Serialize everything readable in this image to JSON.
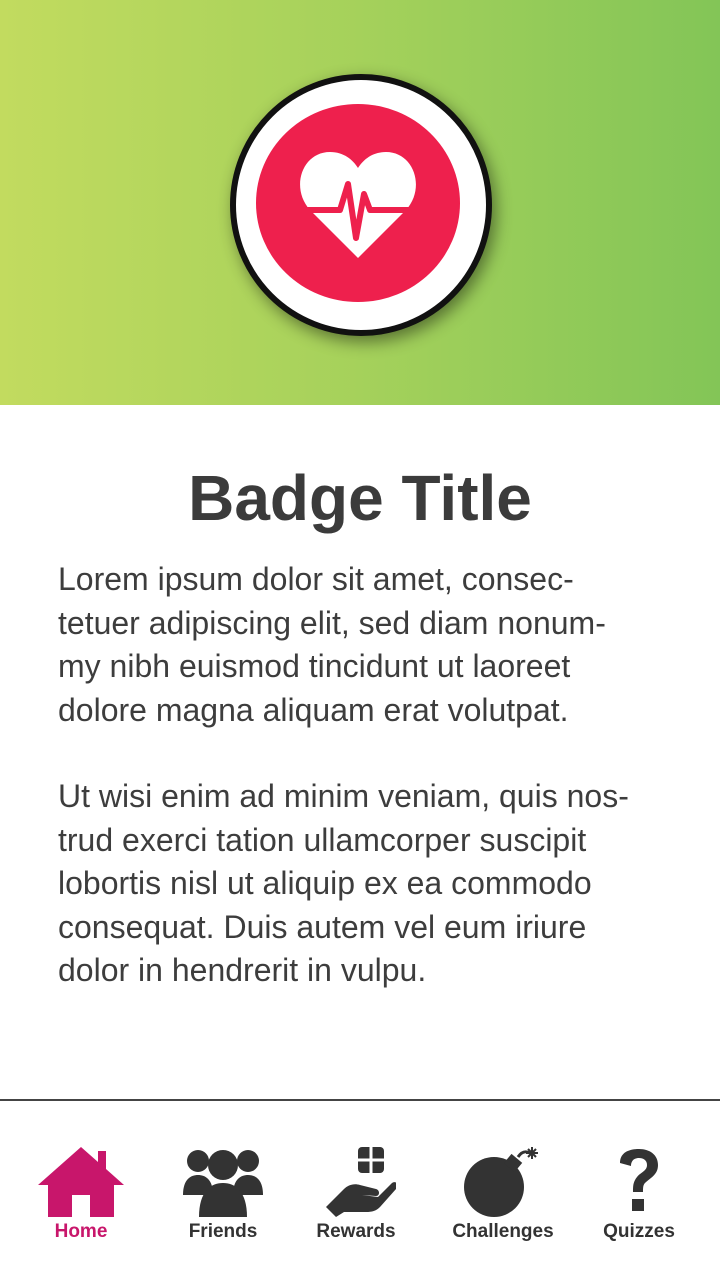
{
  "badge": {
    "icon": "heart-pulse-icon",
    "title": "Badge Title",
    "paragraphs": [
      "Lorem ipsum dolor sit amet, consec-\ntetuer adipiscing elit, sed diam nonum-\nmy nibh euismod tincidunt ut laoreet\ndolore magna aliquam erat volutpat.",
      "Ut wisi enim ad minim veniam, quis nos-\ntrud exerci tation ullamcorper suscipit\nlobortis nisl ut aliquip ex ea commodo\nconsequat. Duis autem vel eum iriure\ndolor in hendrerit in vulpu."
    ]
  },
  "colors": {
    "hero_gradient": [
      "#c2db5f",
      "#83c557"
    ],
    "badge_red": "#ee204d",
    "active": "#c8166b",
    "inactive": "#333333"
  },
  "nav": {
    "items": [
      {
        "label": "Home",
        "icon": "home-icon",
        "active": true
      },
      {
        "label": "Friends",
        "icon": "friends-icon",
        "active": false
      },
      {
        "label": "Rewards",
        "icon": "rewards-icon",
        "active": false
      },
      {
        "label": "Challenges",
        "icon": "bomb-icon",
        "active": false
      },
      {
        "label": "Quizzes",
        "icon": "question-mark-icon",
        "active": false
      }
    ]
  }
}
